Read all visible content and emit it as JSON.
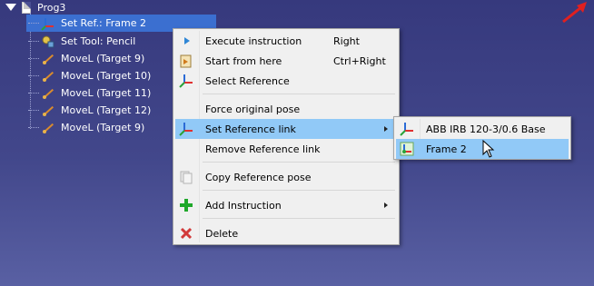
{
  "tree": {
    "root_label": "Prog3",
    "items": [
      {
        "label": "Set Ref.: Frame 2",
        "icon": "reference-frame-icon",
        "selected": true
      },
      {
        "label": "Set Tool: Pencil",
        "icon": "tool-icon",
        "selected": false
      },
      {
        "label": "MoveL (Target 9)",
        "icon": "move-icon",
        "selected": false
      },
      {
        "label": "MoveL (Target 10)",
        "icon": "move-icon",
        "selected": false
      },
      {
        "label": "MoveL (Target 11)",
        "icon": "move-icon",
        "selected": false
      },
      {
        "label": "MoveL (Target 12)",
        "icon": "move-icon",
        "selected": false
      },
      {
        "label": "MoveL (Target 9)",
        "icon": "move-icon",
        "selected": false
      }
    ]
  },
  "context_menu": {
    "items": [
      {
        "label": "Execute instruction",
        "shortcut": "Right",
        "icon": "play-icon"
      },
      {
        "label": "Start from here",
        "shortcut": "Ctrl+Right",
        "icon": "start-here-icon"
      },
      {
        "label": "Select Reference",
        "icon": "axes-icon"
      },
      {
        "label": "Force original pose"
      },
      {
        "label": "Set Reference link",
        "icon": "axes-icon",
        "highlighted": true,
        "has_submenu": true
      },
      {
        "label": "Remove Reference link"
      },
      {
        "label": "Copy Reference pose",
        "icon": "copy-icon"
      },
      {
        "label": "Add Instruction",
        "icon": "plus-icon",
        "has_submenu": true
      },
      {
        "label": "Delete",
        "icon": "delete-x-icon"
      }
    ]
  },
  "submenu": {
    "items": [
      {
        "label": "ABB IRB 120-3/0.6 Base",
        "icon": "axes-icon"
      },
      {
        "label": "Frame 2",
        "icon": "frame-icon",
        "highlighted": true
      }
    ]
  },
  "colors": {
    "highlight": "#91c9f7",
    "tree_selection": "#3b6fd0",
    "background_top": "#36397d",
    "background_bottom": "#5960a3"
  }
}
